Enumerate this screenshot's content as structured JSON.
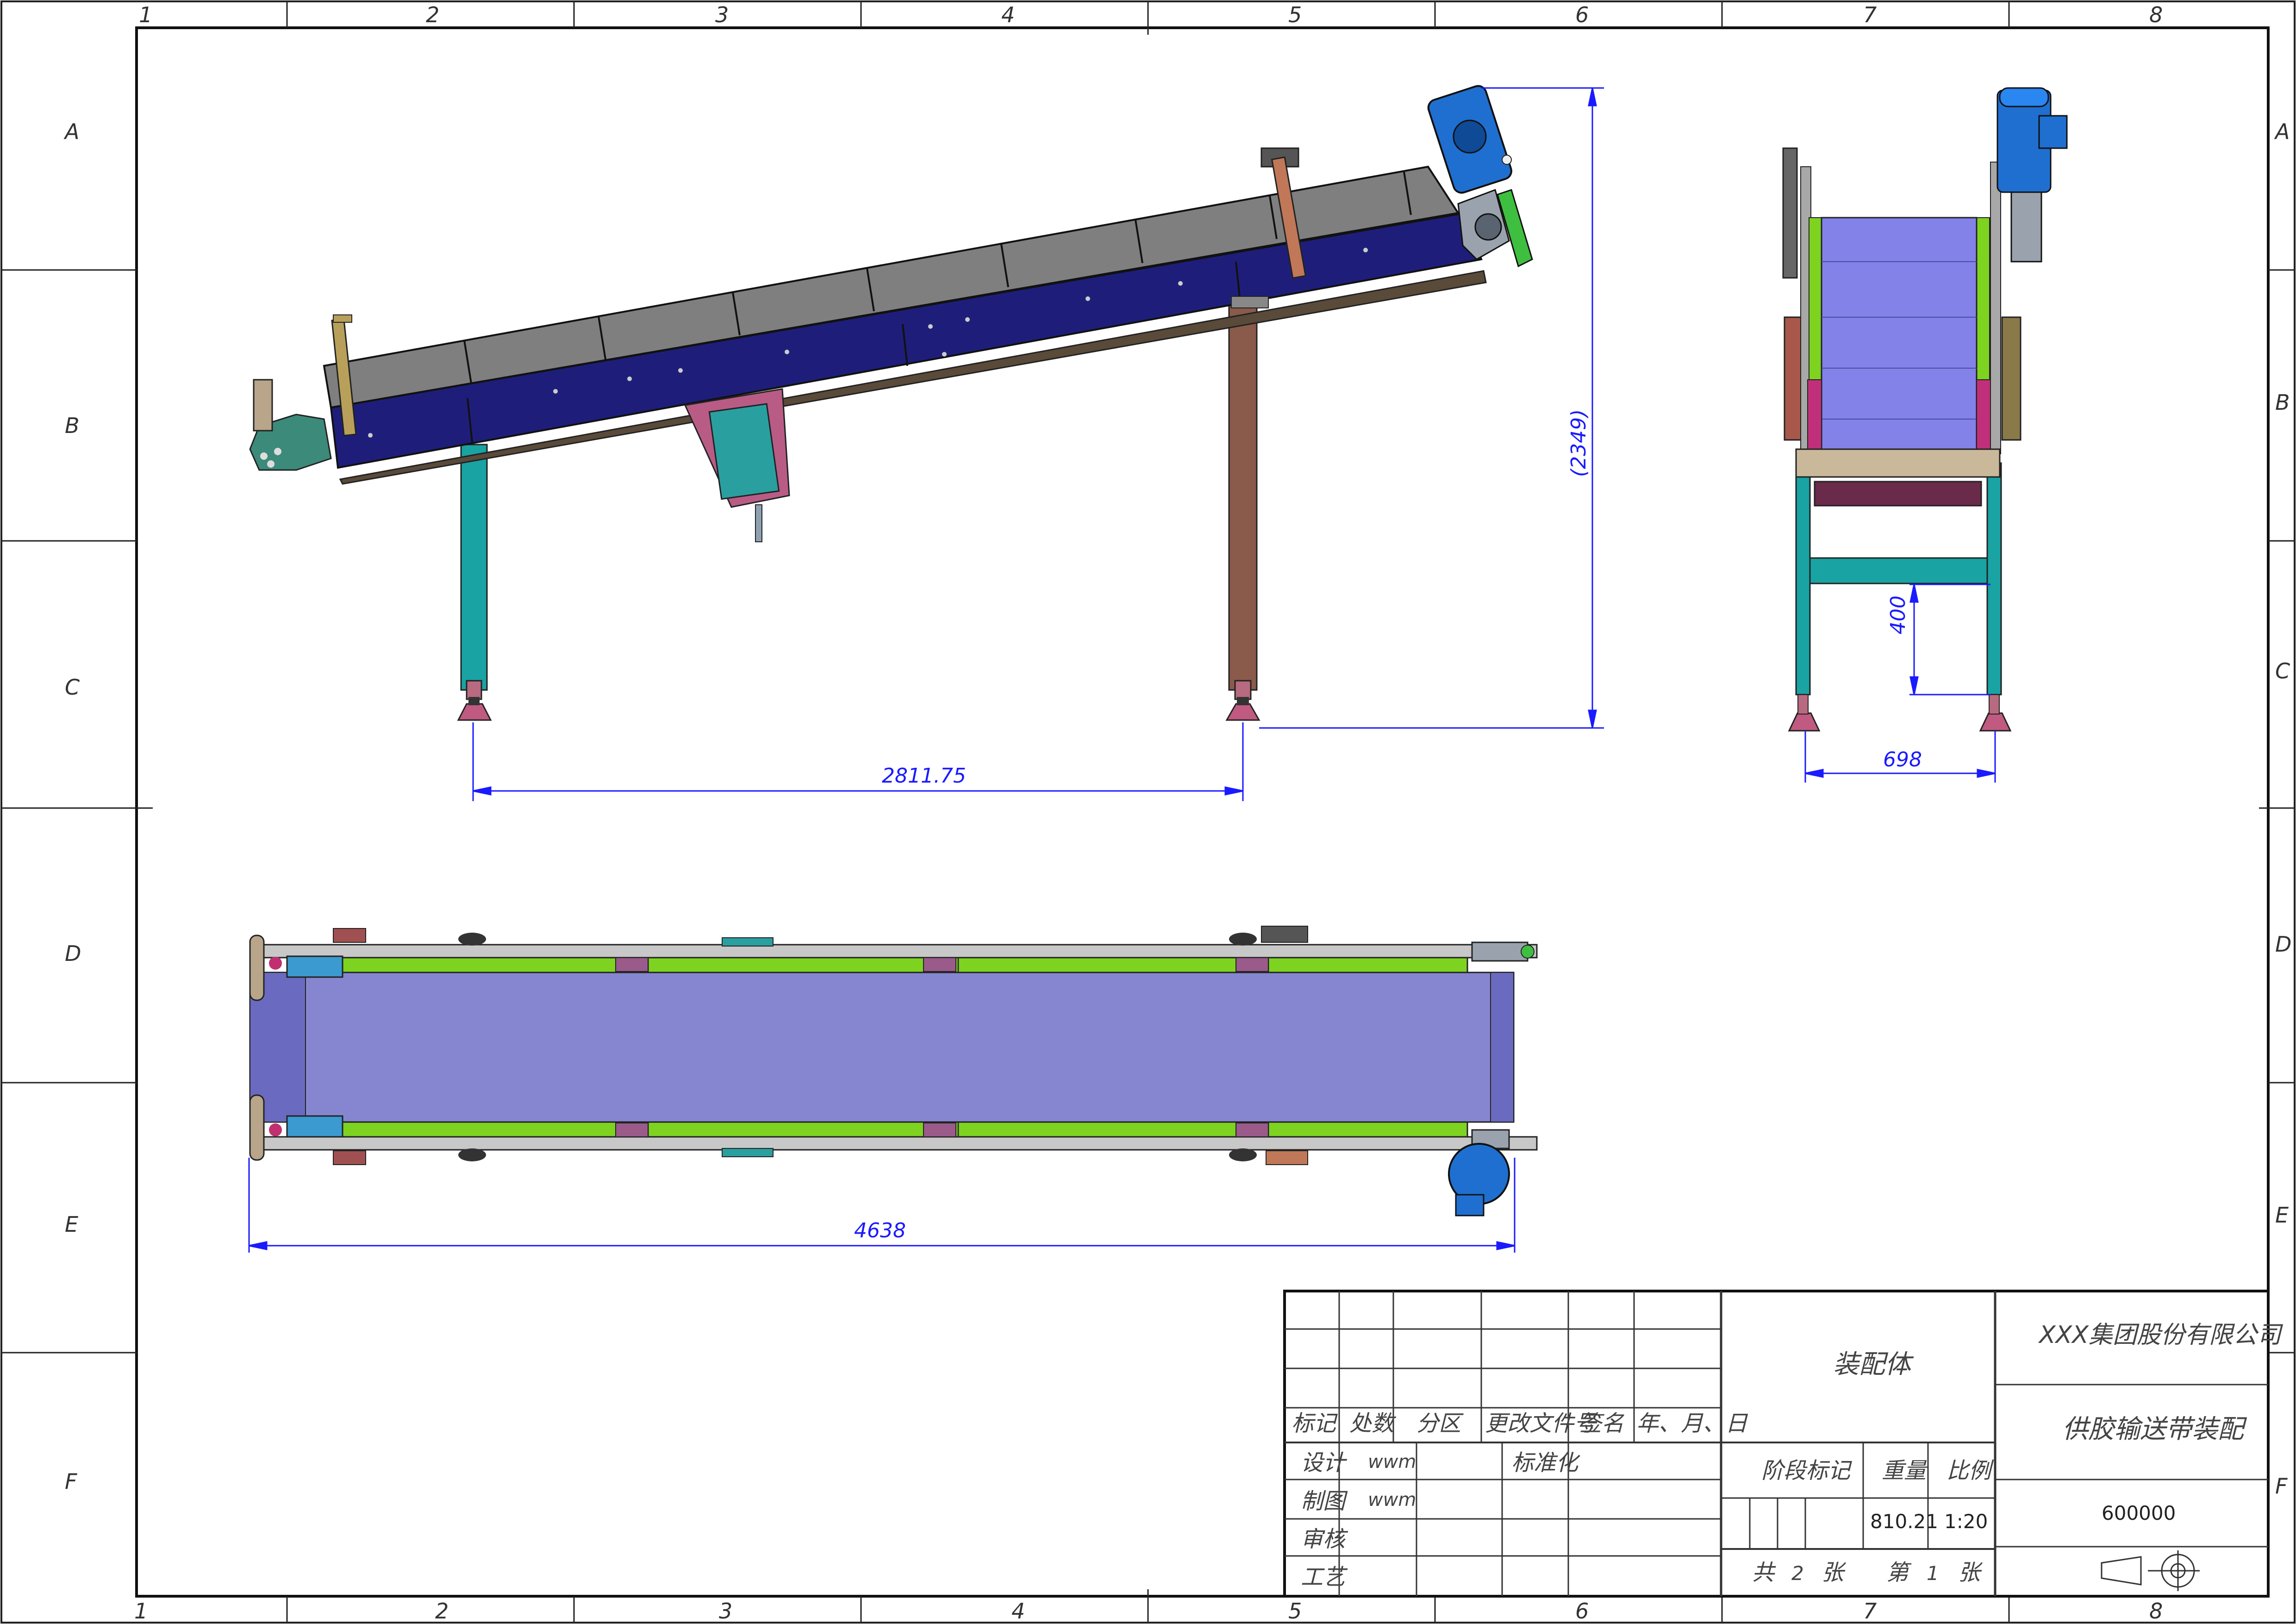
{
  "drawing": {
    "zones": {
      "columns": [
        "1",
        "2",
        "3",
        "4",
        "5",
        "6",
        "7",
        "8"
      ],
      "rows": [
        "A",
        "B",
        "C",
        "D",
        "E",
        "F"
      ]
    },
    "dimensions": {
      "leg_spacing": "2811.75",
      "overall_height": "(2349)",
      "frame_width": "698",
      "crossbar_height": "400",
      "overall_length": "4638"
    }
  },
  "title_block": {
    "revision_headers": {
      "mark": "标记",
      "count": "处数",
      "zone": "分区",
      "change_doc": "更改文件号",
      "signature": "签名",
      "date": "年、月、日"
    },
    "roles": {
      "design": "设计",
      "drafting": "制图",
      "review": "审核",
      "process": "工艺",
      "standardization": "标准化"
    },
    "designer": "wwm",
    "drafter": "wwm",
    "material": "装配体",
    "stage_mark_label": "阶段标记",
    "weight_label": "重量",
    "scale_label": "比例",
    "weight": "810.21",
    "scale": "1:20",
    "sheets_total_prefix": "共",
    "sheets_total": "2",
    "sheets_unit": "张",
    "sheet_no_prefix": "第",
    "sheet_no": "1",
    "sheet_no_unit": "张",
    "company": "XXX集团股份有限公司",
    "drawing_title": "供胶输送带装配",
    "drawing_number": "600000"
  },
  "colors": {
    "belt": "#8686d0",
    "frame": "#1e1e7a",
    "side_plate": "#7a7a7a",
    "leg_front": "#19a3a3",
    "leg_rear": "#8a5a4a",
    "rail": "#7ed321",
    "motor": "#1f6fd0",
    "dimension": "#1a1aff"
  }
}
